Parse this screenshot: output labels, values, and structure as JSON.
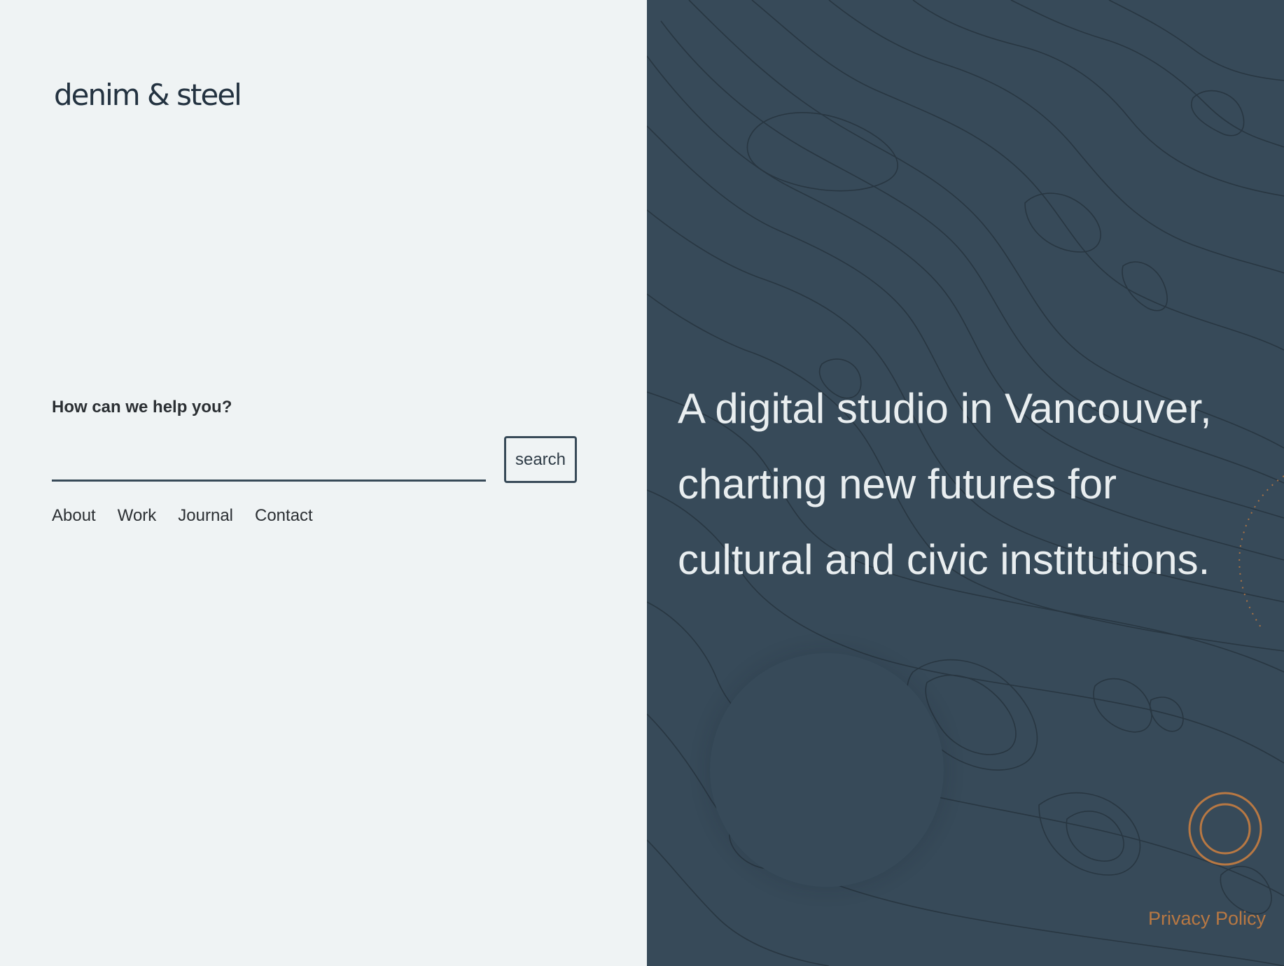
{
  "brand": {
    "logo_text": "denim & steel"
  },
  "search": {
    "label": "How can we help you?",
    "value": "",
    "placeholder": "",
    "button_label": "search"
  },
  "nav": {
    "items": [
      {
        "label": "About"
      },
      {
        "label": "Work"
      },
      {
        "label": "Journal"
      },
      {
        "label": "Contact"
      }
    ]
  },
  "hero": {
    "lines": [
      "A digital studio in Vancouver,",
      "charting new futures for",
      "cultural and civic institutions."
    ]
  },
  "footer": {
    "privacy_label": "Privacy Policy"
  },
  "colors": {
    "left_background": "#eff3f4",
    "right_background": "#374a59",
    "text_dark": "#2b2f33",
    "accent_orange": "#b87843",
    "hero_text": "#e9eef0"
  },
  "icons": {
    "ring": "concentric-circles-icon",
    "background": "topographic-map"
  }
}
